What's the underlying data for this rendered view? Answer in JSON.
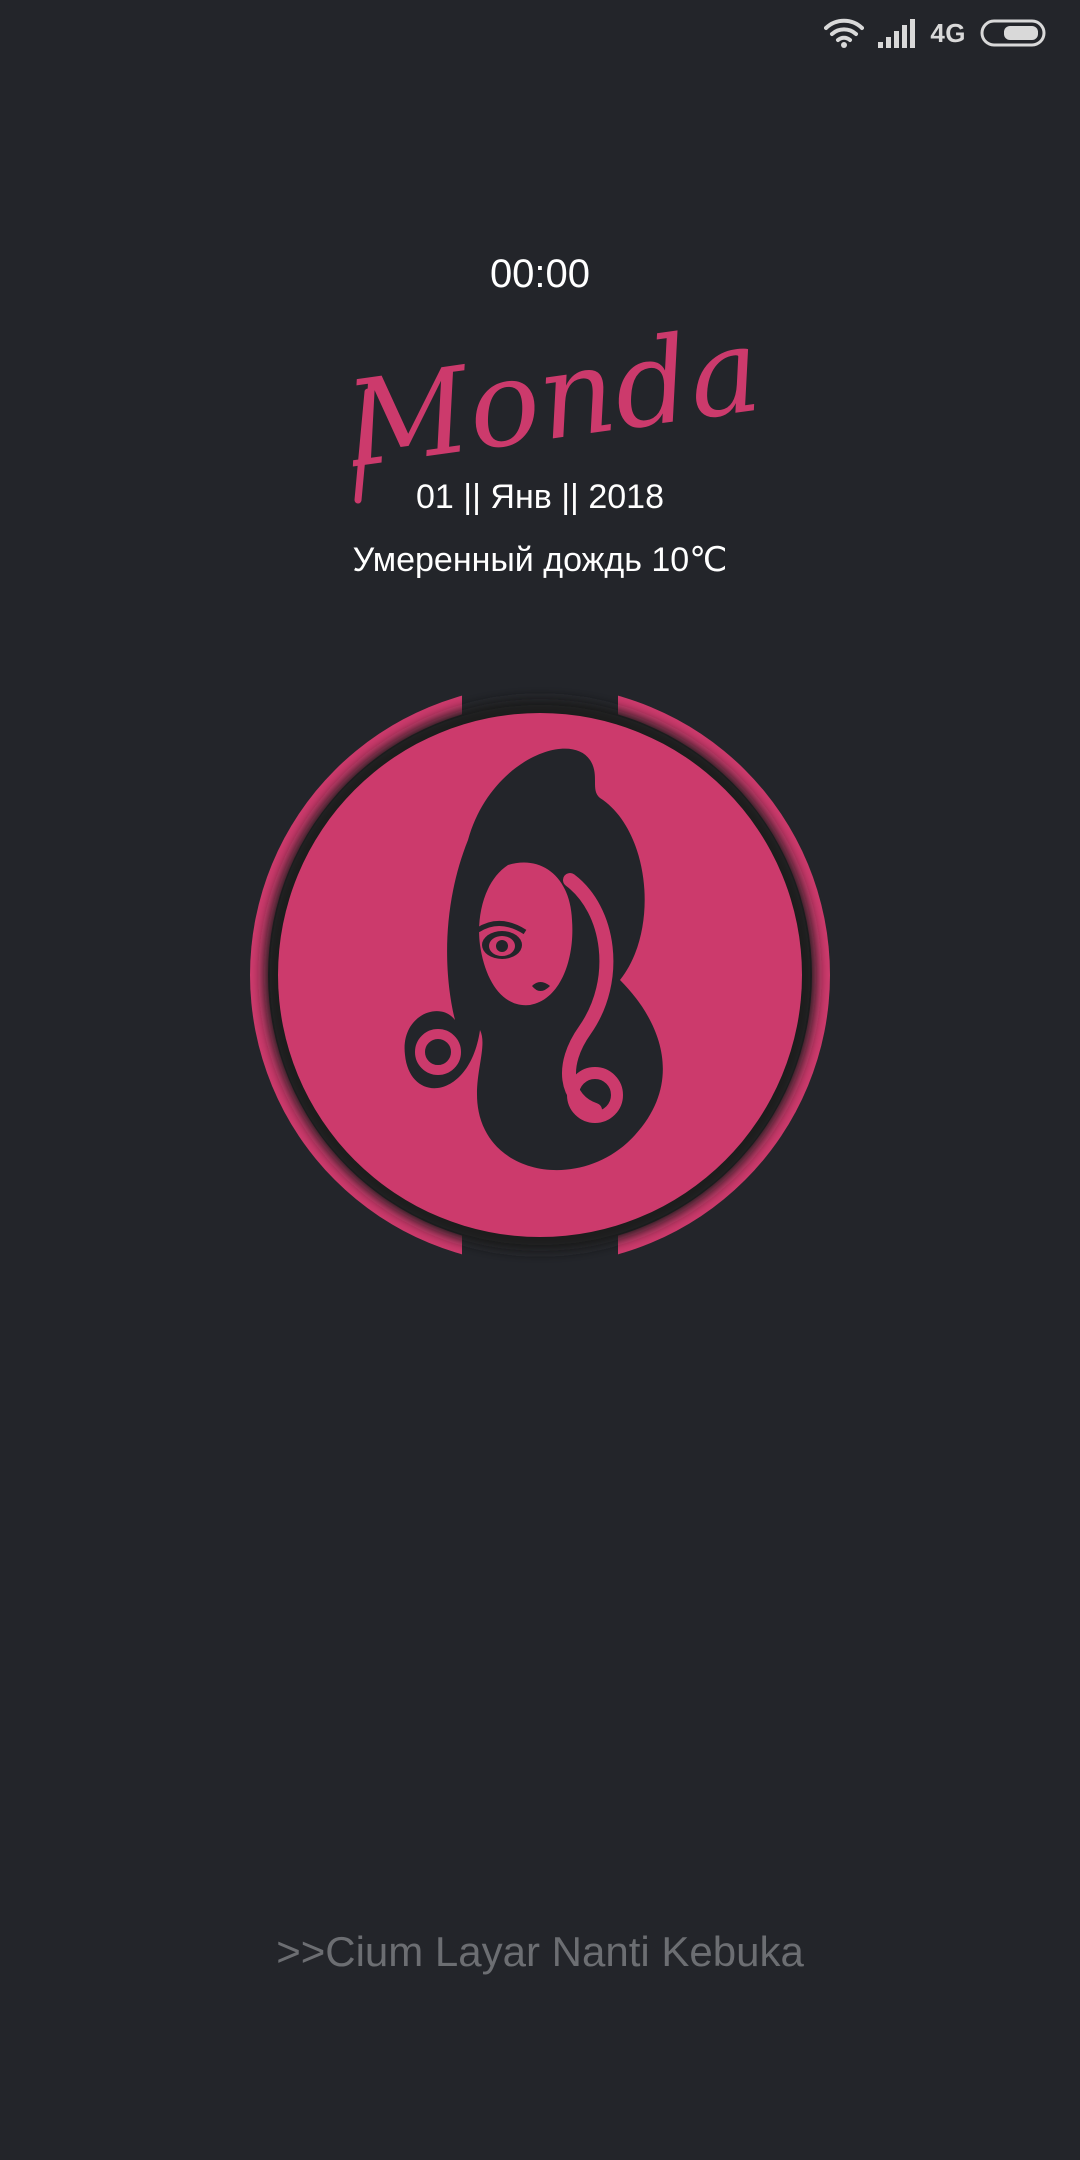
{
  "status_bar": {
    "wifi_icon": "wifi-icon",
    "signal_icon": "cell-signal-icon",
    "network": "4G",
    "battery_icon": "battery-icon"
  },
  "lockscreen": {
    "time": "00:00",
    "day": "Monday",
    "date": "01 || Янв || 2018",
    "weather": "Умеренный дождь 10℃",
    "emblem_icon": "girl-silhouette-icon",
    "unlock_hint": ">>Cium Layar Nanti Kebuka"
  },
  "colors": {
    "background": "#23252a",
    "accent": "#cc3a6c",
    "text": "#ffffff",
    "hint": "#6c6e72"
  }
}
